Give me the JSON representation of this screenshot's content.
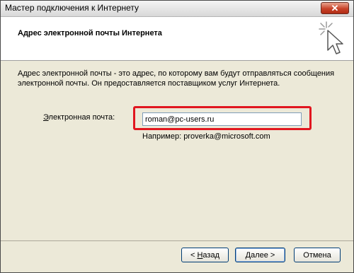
{
  "window": {
    "title": "Мастер подключения к Интернету"
  },
  "header": {
    "title": "Адрес электронной почты Интернета"
  },
  "body": {
    "description": "Адрес электронной почты - это адрес, по которому вам будут отправляться сообщения электронной почты. Он предоставляется поставщиком услуг Интернета.",
    "email_label_underlined": "Э",
    "email_label_rest": "лектронная почта:",
    "email_value": "roman@pc-users.ru",
    "example": "Например: proverka@microsoft.com"
  },
  "buttons": {
    "back_prefix": "< ",
    "back_hotkey": "Н",
    "back_rest": "азад",
    "next_hotkey": "Д",
    "next_rest": "алее >",
    "cancel": "Отмена"
  },
  "colors": {
    "highlight": "#e1161f",
    "close_button": "#c8432a"
  },
  "icons": {
    "close": "close-icon",
    "wizard": "wizard-cursor-icon"
  }
}
